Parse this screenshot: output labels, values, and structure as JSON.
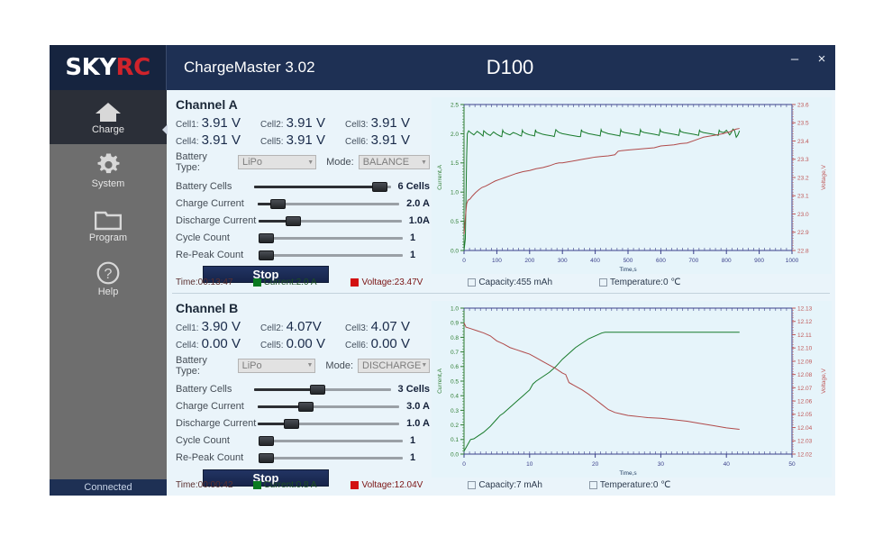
{
  "window": {
    "logo_sky": "SKY",
    "logo_rc": "RC",
    "app_title": "ChargeMaster 3.02",
    "device_title": "D100",
    "minimize_label": "–",
    "close_label": "×"
  },
  "sidebar": {
    "items": [
      {
        "label": "Charge",
        "icon": "home-icon",
        "active": true
      },
      {
        "label": "System",
        "icon": "gear-icon",
        "active": false
      },
      {
        "label": "Program",
        "icon": "folder-icon",
        "active": false
      },
      {
        "label": "Help",
        "icon": "question-icon",
        "active": false
      }
    ],
    "status": "Connected"
  },
  "labels": {
    "battery_type": "Battery Type:",
    "mode": "Mode:",
    "battery_cells": "Battery Cells",
    "charge_current": "Charge Current",
    "discharge_current": "Discharge Current",
    "cycle_count": "Cycle Count",
    "repeak_count": "Re-Peak Count",
    "cell_prefix": "Cell"
  },
  "channels": [
    {
      "title": "Channel A",
      "cells": [
        {
          "label": "Cell1:",
          "value": "3.91 V"
        },
        {
          "label": "Cell2:",
          "value": "3.91 V"
        },
        {
          "label": "Cell3:",
          "value": "3.91 V"
        },
        {
          "label": "Cell4:",
          "value": "3.91 V"
        },
        {
          "label": "Cell5:",
          "value": "3.91 V"
        },
        {
          "label": "Cell6:",
          "value": "3.91 V"
        }
      ],
      "battery_type": "LiPo",
      "mode": "BALANCE",
      "sliders": [
        {
          "name": "Battery Cells",
          "value": "6 Cells",
          "pct": 92
        },
        {
          "name": "Charge Current",
          "value": "2.0 A",
          "pct": 14
        },
        {
          "name": "Discharge Current",
          "value": "1.0A",
          "pct": 24
        },
        {
          "name": "Cycle Count",
          "value": "1",
          "pct": 3
        },
        {
          "name": "Re-Peak Count",
          "value": "1",
          "pct": 3
        }
      ],
      "action_button": "Stop",
      "status": {
        "time": "Time:00:13:47",
        "current": "Current:2.0 A",
        "voltage": "Voltage:23.47V",
        "capacity": "Capacity:455 mAh",
        "temperature": "Temperature:0 ℃"
      }
    },
    {
      "title": "Channel B",
      "cells": [
        {
          "label": "Cell1:",
          "value": "3.90 V"
        },
        {
          "label": "Cell2:",
          "value": "4.07V"
        },
        {
          "label": "Cell3:",
          "value": "4.07 V"
        },
        {
          "label": "Cell4:",
          "value": "0.00 V"
        },
        {
          "label": "Cell5:",
          "value": "0.00 V"
        },
        {
          "label": "Cell6:",
          "value": "0.00 V"
        }
      ],
      "battery_type": "LiPo",
      "mode": "DISCHARGE",
      "sliders": [
        {
          "name": "Battery Cells",
          "value": "3 Cells",
          "pct": 46
        },
        {
          "name": "Charge Current",
          "value": "3.0 A",
          "pct": 34
        },
        {
          "name": "Discharge Current",
          "value": "1.0 A",
          "pct": 24
        },
        {
          "name": "Cycle Count",
          "value": "1",
          "pct": 3
        },
        {
          "name": "Re-Peak Count",
          "value": "1",
          "pct": 3
        }
      ],
      "action_button": "Stop",
      "status": {
        "time": "Time:00:00:42",
        "current": "Current:0.8 A",
        "voltage": "Voltage:12.04V",
        "capacity": "Capacity:7 mAh",
        "temperature": "Temperature:0 ℃"
      }
    }
  ],
  "chart_data": [
    {
      "type": "line",
      "title": "",
      "xlabel": "Time,s",
      "ylabel": "Current,A",
      "y2label": "Voltage,V",
      "xlim": [
        0,
        1000
      ],
      "xticks": [
        0,
        100,
        200,
        300,
        400,
        500,
        600,
        700,
        800,
        900,
        1000
      ],
      "ylim": [
        0.0,
        2.5
      ],
      "yticks": [
        0.0,
        0.5,
        1.0,
        1.5,
        2.0,
        2.5
      ],
      "y2lim": [
        22.8,
        23.6
      ],
      "y2ticks": [
        22.8,
        22.9,
        23.0,
        23.1,
        23.2,
        23.3,
        23.4,
        23.5,
        23.6
      ],
      "grid": false,
      "legend": "none",
      "series": [
        {
          "name": "Current,A",
          "color": "#177a2a",
          "axis": "left",
          "x": [
            0,
            4,
            8,
            10,
            14,
            20,
            30,
            40,
            50,
            58,
            60,
            70,
            80,
            90,
            100,
            110,
            115,
            118,
            120,
            130,
            140,
            150,
            160,
            170,
            175,
            178,
            180,
            190,
            200,
            210,
            215,
            218,
            220,
            230,
            240,
            250,
            260,
            270,
            275,
            280,
            285,
            290,
            300,
            310,
            320,
            330,
            340,
            350,
            355,
            358,
            360,
            370,
            380,
            390,
            400,
            410,
            415,
            418,
            420,
            430,
            440,
            450,
            460,
            470,
            475,
            478,
            480,
            490,
            500,
            510,
            520,
            530,
            535,
            538,
            540,
            550,
            560,
            570,
            580,
            590,
            595,
            598,
            600,
            610,
            620,
            630,
            640,
            650,
            655,
            658,
            660,
            670,
            680,
            690,
            700,
            710,
            715,
            718,
            720,
            730,
            740,
            750,
            760,
            770,
            775,
            778,
            780,
            790,
            795,
            800,
            805,
            810,
            815,
            820,
            825,
            830,
            835,
            840
          ],
          "y": [
            0.0,
            0.2,
            1.6,
            2.0,
            2.05,
            2.02,
            1.98,
            2.04,
            2.0,
            1.96,
            2.05,
            2.0,
            1.97,
            2.03,
            1.99,
            1.96,
            1.95,
            2.06,
            2.03,
            2.0,
            1.98,
            2.02,
            2.0,
            1.97,
            1.96,
            2.06,
            2.03,
            2.0,
            1.98,
            1.97,
            1.96,
            2.07,
            2.03,
            2.01,
            1.99,
            1.98,
            1.97,
            1.96,
            1.95,
            2.07,
            2.04,
            2.02,
            2.0,
            1.99,
            1.98,
            1.97,
            1.96,
            1.95,
            1.95,
            2.07,
            2.04,
            2.02,
            2.0,
            1.99,
            1.98,
            1.97,
            1.96,
            2.07,
            2.04,
            2.02,
            2.0,
            1.99,
            1.98,
            1.97,
            1.96,
            2.07,
            2.04,
            2.02,
            2.01,
            2.0,
            1.99,
            1.98,
            1.97,
            2.07,
            2.04,
            2.02,
            2.01,
            2.0,
            1.99,
            1.98,
            1.97,
            2.07,
            2.04,
            2.02,
            2.01,
            2.0,
            1.99,
            1.98,
            1.97,
            2.07,
            2.04,
            2.02,
            2.01,
            2.0,
            1.99,
            1.98,
            1.97,
            2.06,
            2.04,
            2.02,
            2.01,
            2.0,
            1.99,
            1.98,
            1.97,
            2.06,
            2.04,
            2.02,
            2.03,
            2.06,
            2.02,
            1.98,
            2.02,
            2.08,
            2.05,
            1.94,
            1.98,
            2.05,
            2.04
          ]
        },
        {
          "name": "Voltage,V",
          "color": "#b04a4a",
          "axis": "right",
          "x": [
            0,
            2,
            4,
            6,
            8,
            12,
            18,
            25,
            35,
            45,
            55,
            65,
            75,
            85,
            95,
            110,
            125,
            140,
            160,
            180,
            200,
            220,
            240,
            260,
            280,
            290,
            300,
            320,
            340,
            360,
            380,
            400,
            420,
            440,
            460,
            470,
            480,
            500,
            520,
            540,
            560,
            580,
            600,
            620,
            640,
            660,
            680,
            700,
            720,
            730,
            740,
            750,
            760,
            770,
            780,
            790,
            800,
            810,
            820,
            830,
            840
          ],
          "y": [
            0.28,
            0.42,
            0.55,
            0.68,
            0.8,
            0.86,
            0.88,
            0.93,
            0.99,
            1.04,
            1.08,
            1.1,
            1.13,
            1.16,
            1.19,
            1.22,
            1.25,
            1.28,
            1.32,
            1.35,
            1.37,
            1.4,
            1.42,
            1.45,
            1.49,
            1.5,
            1.5,
            1.52,
            1.54,
            1.56,
            1.58,
            1.6,
            1.61,
            1.62,
            1.64,
            1.7,
            1.71,
            1.72,
            1.73,
            1.74,
            1.75,
            1.76,
            1.79,
            1.8,
            1.81,
            1.83,
            1.84,
            1.88,
            1.92,
            1.94,
            1.95,
            1.96,
            1.97,
            1.98,
            1.99,
            2.0,
            2.02,
            2.03,
            2.06,
            2.08,
            2.09
          ]
        }
      ]
    },
    {
      "type": "line",
      "title": "",
      "xlabel": "Time,s",
      "ylabel": "Current,A",
      "y2label": "Voltage,V",
      "xlim": [
        0,
        50
      ],
      "xticks": [
        0,
        10,
        20,
        30,
        40,
        50
      ],
      "ylim": [
        0.0,
        1.0
      ],
      "yticks": [
        0.0,
        0.1,
        0.2,
        0.3,
        0.4,
        0.5,
        0.6,
        0.7,
        0.8,
        0.9,
        1.0
      ],
      "y2lim": [
        12.02,
        12.13
      ],
      "y2ticks": [
        12.02,
        12.03,
        12.04,
        12.05,
        12.06,
        12.07,
        12.08,
        12.09,
        12.1,
        12.11,
        12.12,
        12.13
      ],
      "grid": false,
      "legend": "none",
      "series": [
        {
          "name": "Current,A",
          "color": "#177a2a",
          "axis": "left",
          "x": [
            0,
            0.5,
            1,
            1.5,
            2,
            3,
            4,
            5,
            5.5,
            6,
            7,
            8,
            9,
            10,
            10.5,
            11,
            12,
            13,
            14,
            15,
            16,
            17,
            18,
            19,
            20,
            21,
            21.5,
            22,
            25,
            30,
            35,
            40,
            42
          ],
          "y": [
            0.02,
            0.06,
            0.1,
            0.105,
            0.12,
            0.15,
            0.19,
            0.24,
            0.265,
            0.28,
            0.32,
            0.36,
            0.4,
            0.44,
            0.48,
            0.5,
            0.53,
            0.56,
            0.6,
            0.65,
            0.69,
            0.73,
            0.76,
            0.79,
            0.81,
            0.83,
            0.835,
            0.835,
            0.835,
            0.835,
            0.835,
            0.835,
            0.835
          ]
        },
        {
          "name": "Voltage,V",
          "color": "#b04a4a",
          "axis": "right",
          "x": [
            0,
            0.3,
            1,
            2,
            3,
            4,
            5,
            5.5,
            6,
            7,
            8,
            9,
            10,
            11,
            12,
            13,
            14,
            15,
            15.5,
            16,
            17,
            18,
            19,
            20,
            21,
            22,
            23,
            24,
            25,
            26,
            27,
            28,
            30,
            32,
            34,
            36,
            38,
            40,
            42
          ],
          "y": [
            0.9,
            0.87,
            0.86,
            0.845,
            0.83,
            0.81,
            0.775,
            0.765,
            0.755,
            0.73,
            0.715,
            0.7,
            0.685,
            0.66,
            0.635,
            0.61,
            0.585,
            0.555,
            0.545,
            0.49,
            0.465,
            0.44,
            0.41,
            0.375,
            0.34,
            0.305,
            0.285,
            0.275,
            0.265,
            0.26,
            0.255,
            0.25,
            0.245,
            0.235,
            0.225,
            0.21,
            0.195,
            0.18,
            0.17
          ]
        }
      ]
    }
  ]
}
